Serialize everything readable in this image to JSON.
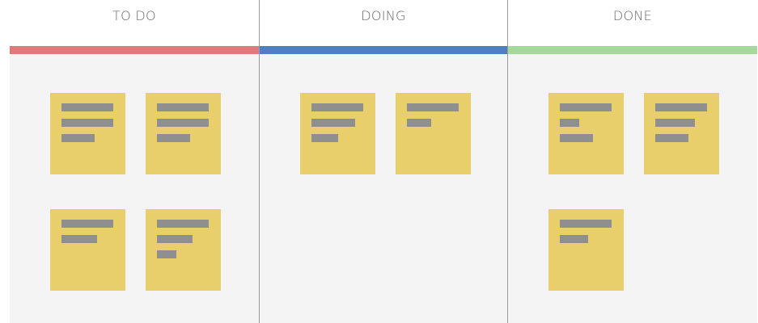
{
  "board": {
    "columns": [
      {
        "title": "TO DO",
        "accent": "#dd7b7b",
        "notes": [
          {
            "line_fractions": [
              1.0,
              1.0,
              0.64
            ]
          },
          {
            "line_fractions": [
              1.0,
              1.0,
              0.64
            ]
          },
          {
            "line_fractions": [
              1.0,
              0.68
            ]
          },
          {
            "line_fractions": [
              1.0,
              0.68,
              0.38
            ]
          }
        ]
      },
      {
        "title": "DOING",
        "accent": "#4f7fbe",
        "notes": [
          {
            "line_fractions": [
              1.0,
              0.84,
              0.52
            ]
          },
          {
            "line_fractions": [
              1.0,
              0.47
            ]
          }
        ]
      },
      {
        "title": "DONE",
        "accent": "#a4d99a",
        "notes": [
          {
            "line_fractions": [
              1.0,
              0.38,
              0.64
            ]
          },
          {
            "line_fractions": [
              1.0,
              0.77,
              0.64
            ]
          },
          {
            "line_fractions": [
              1.0,
              0.54
            ]
          }
        ]
      }
    ],
    "note_color": "#e8cf6b",
    "line_color": "#8f8f8f",
    "body_color": "#f4f4f4",
    "divider_color": "#9a9a9a"
  }
}
